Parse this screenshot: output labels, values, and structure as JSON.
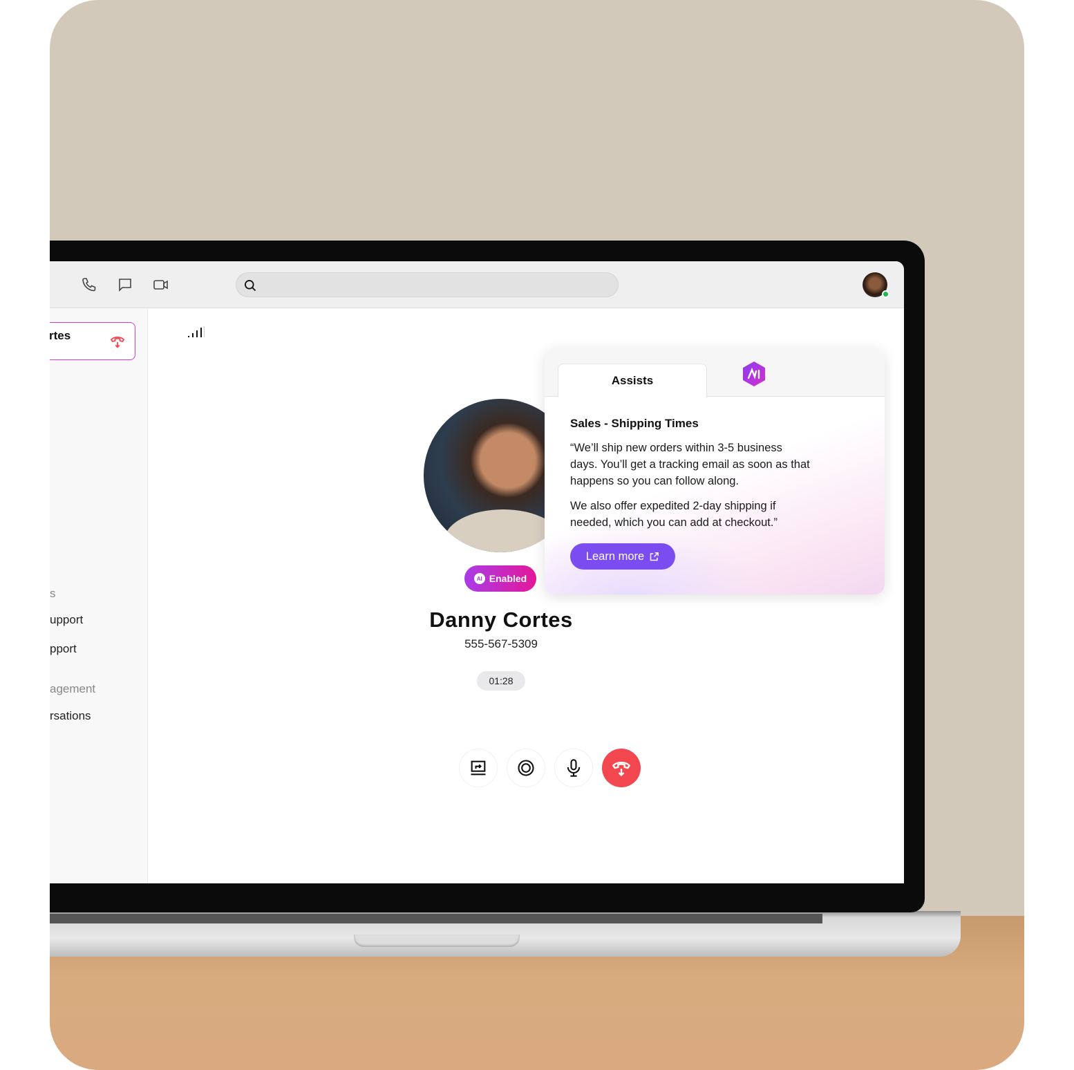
{
  "topbar": {
    "icons": [
      "phone-icon",
      "chat-icon",
      "video-icon"
    ],
    "search": {
      "placeholder": "",
      "icon": "search-icon"
    },
    "user_status": "online"
  },
  "sidebar": {
    "active_call": {
      "name": "rtes",
      "icon": "hang-up-icon"
    },
    "items": [
      {
        "label": "s",
        "muted": true
      },
      {
        "label": "upport"
      },
      {
        "label": "pport"
      },
      {
        "label": "agement",
        "muted": true
      },
      {
        "label": "rsations"
      }
    ]
  },
  "call": {
    "name": "Danny Cortes",
    "phone": "555-567-5309",
    "duration": "01:28",
    "ai_badge": "Enabled",
    "controls": [
      "share-screen-icon",
      "record-icon",
      "microphone-icon",
      "hang-up-icon"
    ]
  },
  "assist": {
    "tab": "Assists",
    "title": "Sales - Shipping Times",
    "paragraphs": [
      "“We’ll ship new orders within 3-5 business days. You’ll get a tracking email as soon as that happens so you can follow along.",
      "We also offer expedited 2-day shipping if needed, which you can add at checkout.”"
    ],
    "button": "Learn more"
  },
  "colors": {
    "accent": "#7b4df0",
    "end_call": "#f2474f",
    "badge_start": "#a93ce6",
    "badge_end": "#e4179a"
  }
}
